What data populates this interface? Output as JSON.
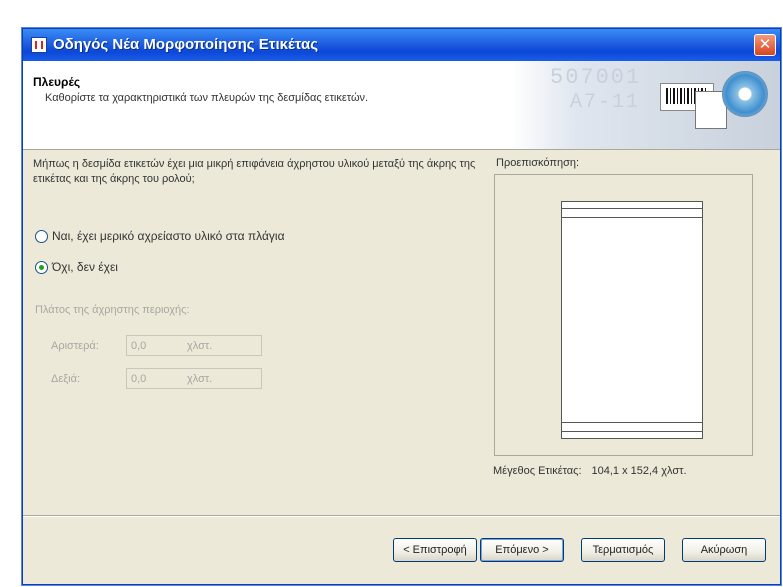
{
  "window": {
    "title": "Οδηγός Νέα Μορφοποίησης Ετικέτας",
    "close_glyph": "✕"
  },
  "header": {
    "title": "Πλευρές",
    "subtitle": "Καθορίστε τα χαρακτηριστικά των πλευρών της δεσμίδας ετικετών.",
    "art_digits_1": "507001",
    "art_digits_2": "A7-11"
  },
  "main": {
    "question": "Μήπως η δεσμίδα ετικετών έχει μια μικρή επιφάνεια άχρηστου υλικού μεταξύ της άκρης της ετικέτας και της άκρης του ρολού;",
    "options": [
      {
        "label": "Ναι, έχει μερικό αχρείαστο υλικό στα πλάγια",
        "checked": false
      },
      {
        "label": "Όχι, δεν έχει",
        "checked": true
      }
    ],
    "width_group_label": "Πλάτος της άχρηστης περιοχής:",
    "left_field": {
      "label": "Αριστερά:",
      "value": "0,0",
      "unit": "χλστ."
    },
    "right_field": {
      "label": "Δεξιά:",
      "value": "0,0",
      "unit": "χλστ."
    }
  },
  "preview": {
    "label": "Προεπισκόπηση:",
    "size_label": "Μέγεθος Ετικέτας:",
    "size_value": "104,1 x 152,4 χλστ."
  },
  "buttons": {
    "back": "< Επιστροφή",
    "next": "Επόμενο >",
    "finish": "Τερματισμός",
    "cancel": "Ακύρωση"
  },
  "icons": [
    "app-icon",
    "close-icon",
    "radio-icon",
    "barcode-icon",
    "disc-icon"
  ],
  "colors": {
    "titlebar": "#0b48d8",
    "face": "#ece9d8",
    "radio_dot": "#21a121"
  }
}
